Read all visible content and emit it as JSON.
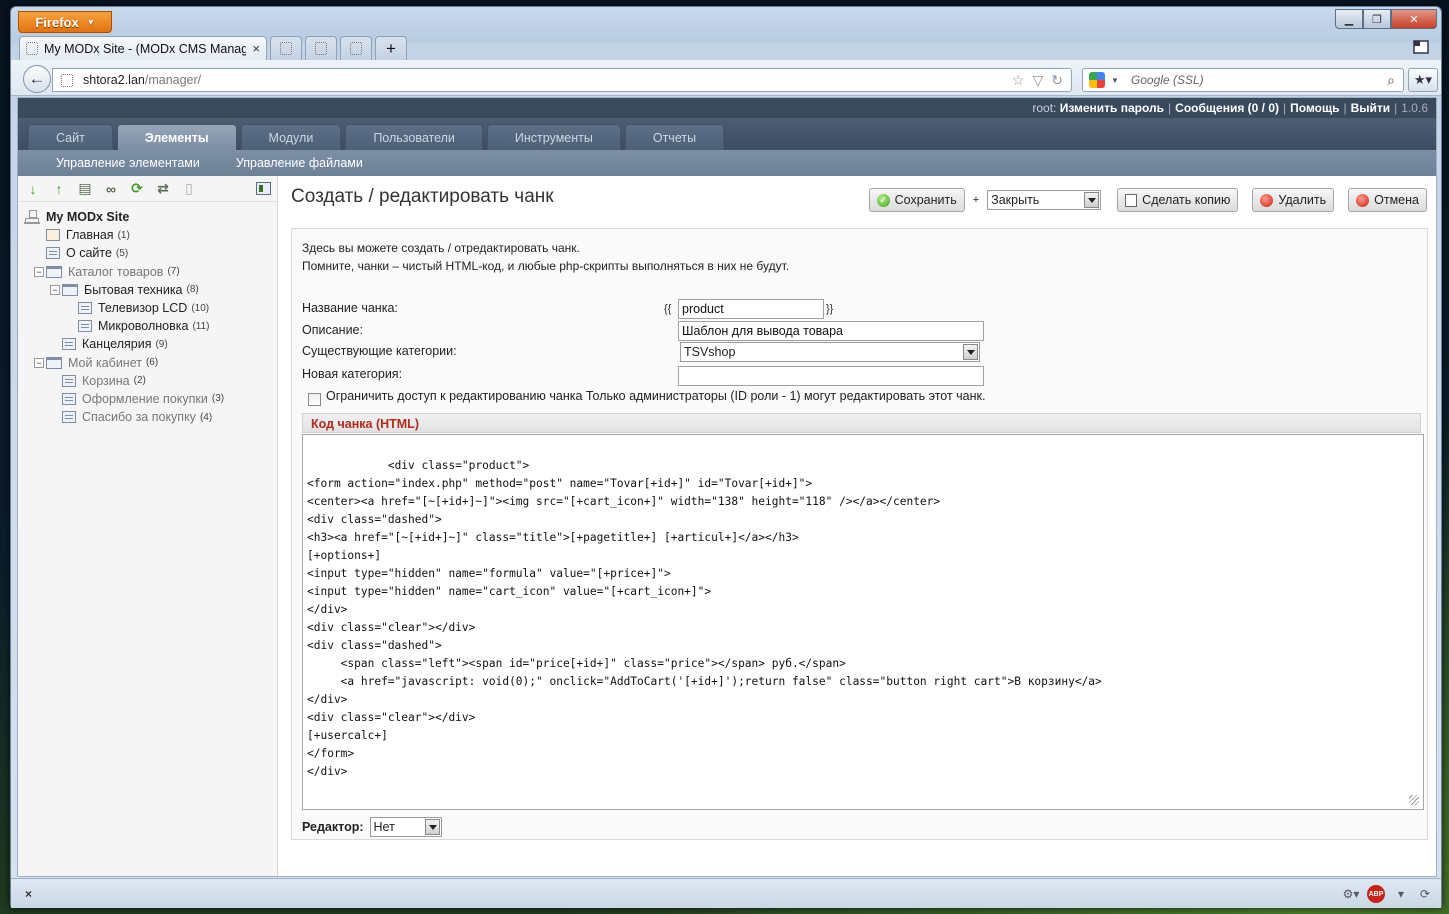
{
  "browser": {
    "app_button": "Firefox",
    "tabs": [
      {
        "title": "My MODx Site - (MODx CMS Manager)",
        "close": "×"
      }
    ],
    "new_tab": "+",
    "url_host": "shtora2.lan",
    "url_path": "/manager/",
    "search_placeholder": "Google (SSL)"
  },
  "manager": {
    "top_links": {
      "user": "root:",
      "change_password": "Изменить пароль",
      "messages": "Сообщения (0 / 0)",
      "help": "Помощь",
      "logout": "Выйти",
      "version": "1.0.6"
    },
    "menu": [
      "Сайт",
      "Элементы",
      "Модули",
      "Пользователи",
      "Инструменты",
      "Отчеты"
    ],
    "active_menu": "Элементы",
    "submenu": [
      "Управление элементами",
      "Управление файлами"
    ]
  },
  "tree": {
    "root": "My MODx Site",
    "nodes": [
      {
        "label": "Главная",
        "count": "(1)"
      },
      {
        "label": "О сайте",
        "count": "(5)"
      },
      {
        "label": "Каталог товаров",
        "count": "(7)"
      },
      {
        "label": "Бытовая техника",
        "count": "(8)"
      },
      {
        "label": "Телевизор LCD",
        "count": "(10)"
      },
      {
        "label": "Микроволновка",
        "count": "(11)"
      },
      {
        "label": "Канцелярия",
        "count": "(9)"
      },
      {
        "label": "Мой кабинет",
        "count": "(6)"
      },
      {
        "label": "Корзина",
        "count": "(2)"
      },
      {
        "label": "Оформление покупки",
        "count": "(3)"
      },
      {
        "label": "Спасибо за покупку",
        "count": "(4)"
      }
    ]
  },
  "page": {
    "title": "Создать / редактировать чанк",
    "actions": {
      "save": "Сохранить",
      "plus": "+",
      "after_save": "Закрыть",
      "duplicate": "Сделать копию",
      "delete": "Удалить",
      "cancel": "Отмена"
    },
    "intro_line1": "Здесь вы можете создать / отредактировать чанк.",
    "intro_line2": "Помните, чанки – чистый HTML-код, и любые php-скрипты выполняться в них не будут.",
    "fields": {
      "name_label": "Название чанка:",
      "name_value": "product",
      "brace_open": "{{",
      "brace_close": "}}",
      "desc_label": "Описание:",
      "desc_value": "Шаблон для вывода товара",
      "cat_label": "Существующие категории:",
      "cat_value": "TSVshop",
      "newcat_label": "Новая категория:",
      "newcat_value": "",
      "lock_label": "Ограничить доступ к редактированию чанка Только администраторы (ID роли - 1) могут редактировать этот чанк."
    },
    "code_header": "Код чанка (HTML)",
    "code": "<div class=\"product\">\n<form action=\"index.php\" method=\"post\" name=\"Tovar[+id+]\" id=\"Tovar[+id+]\">\n<center><a href=\"[~[+id+]~]\"><img src=\"[+cart_icon+]\" width=\"138\" height=\"118\" /></a></center>\n<div class=\"dashed\">\n<h3><a href=\"[~[+id+]~]\" class=\"title\">[+pagetitle+] [+articul+]</a></h3>\n[+options+]\n<input type=\"hidden\" name=\"formula\" value=\"[+price+]\">\n<input type=\"hidden\" name=\"cart_icon\" value=\"[+cart_icon+]\">\n</div>\n<div class=\"clear\"></div>\n<div class=\"dashed\">\n     <span class=\"left\"><span id=\"price[+id+]\" class=\"price\"></span> руб.</span>\n     <a href=\"javascript: void(0);\" onclick=\"AddToCart('[+id+]');return false\" class=\"button right cart\">В корзину</a>\n</div>\n<div class=\"clear\"></div>\n[+usercalc+]\n</form>\n</div>",
    "editor_label": "Редактор:",
    "editor_value": "Нет"
  },
  "statusbar": {
    "close": "×",
    "abp": "ABP"
  }
}
